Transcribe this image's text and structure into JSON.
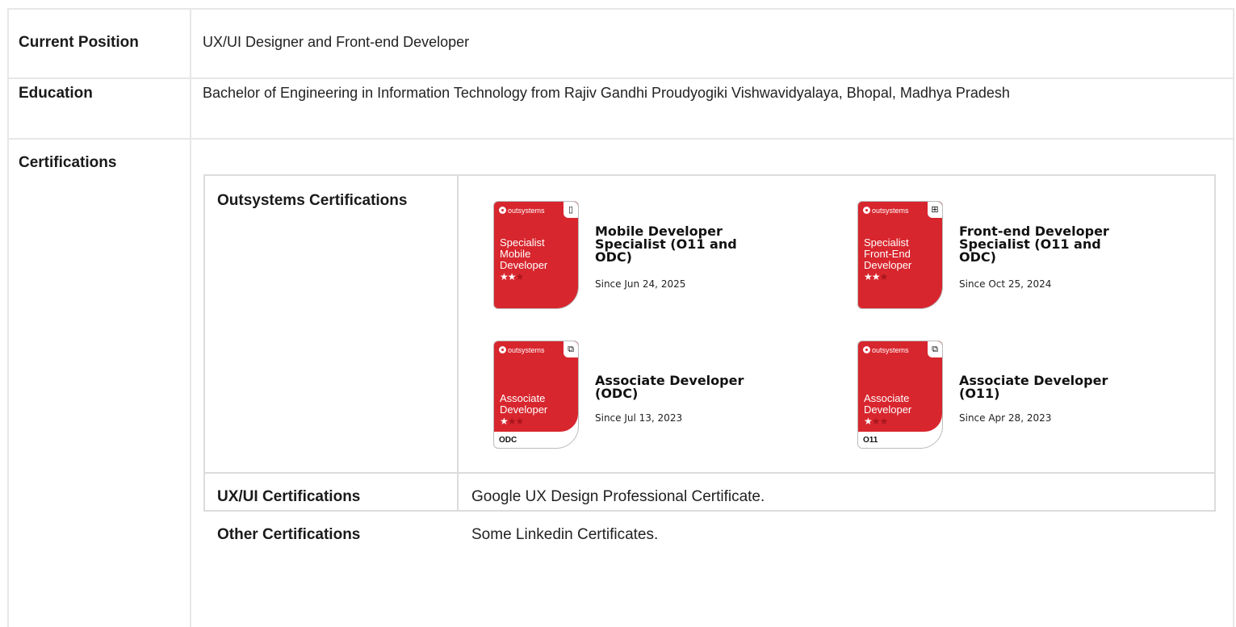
{
  "rows": {
    "position": {
      "label": "Current Position",
      "value": "UX/UI Designer and Front-end Developer"
    },
    "education": {
      "label": "Education",
      "value": "Bachelor of Engineering in Information Technology from Rajiv Gandhi Proudyogiki Vishwavidyalaya, Bhopal, Madhya Pradesh"
    },
    "certifications": {
      "label": "Certifications"
    }
  },
  "cert_table": {
    "outsystems": {
      "label": "Outsystems Certifications",
      "badges": [
        {
          "brand": "outsystems",
          "line1": "Specialist",
          "line2": "Mobile",
          "line3": "Developer",
          "title": "Mobile Developer Specialist (O11 and ODC)",
          "since": "Since Jun 24, 2025",
          "stars_on": "★★",
          "stars_off": "★",
          "footer": "",
          "icon": "mobile-icon",
          "icon_char": "▯"
        },
        {
          "brand": "outsystems",
          "line1": "Specialist",
          "line2": "Front-End",
          "line3": "Developer",
          "title": "Front-end Developer Specialist (O11 and ODC)",
          "since": "Since Oct 25, 2024",
          "stars_on": "★★",
          "stars_off": "★",
          "footer": "",
          "icon": "layout-icon",
          "icon_char": "⊞"
        },
        {
          "brand": "outsystems",
          "line1": "",
          "line2": "Associate",
          "line3": "Developer",
          "title": "Associate Developer (ODC)",
          "since": "Since Jul 13, 2023",
          "stars_on": "★",
          "stars_off": "★★",
          "footer": "ODC",
          "icon": "code-box-icon",
          "icon_char": "⧉"
        },
        {
          "brand": "outsystems",
          "line1": "",
          "line2": "Associate",
          "line3": "Developer",
          "title": "Associate Developer (O11)",
          "since": "Since Apr 28, 2023",
          "stars_on": "★",
          "stars_off": "★★",
          "footer": "O11",
          "icon": "code-box-icon",
          "icon_char": "⧉"
        }
      ]
    },
    "uxui": {
      "label": "UX/UI Certifications",
      "value": "Google UX Design Professional Certificate."
    },
    "other": {
      "label": "Other Certifications",
      "value": "Some Linkedin Certificates."
    }
  },
  "colors": {
    "badge_red": "#d8262e",
    "border": "#e7e7e7"
  }
}
